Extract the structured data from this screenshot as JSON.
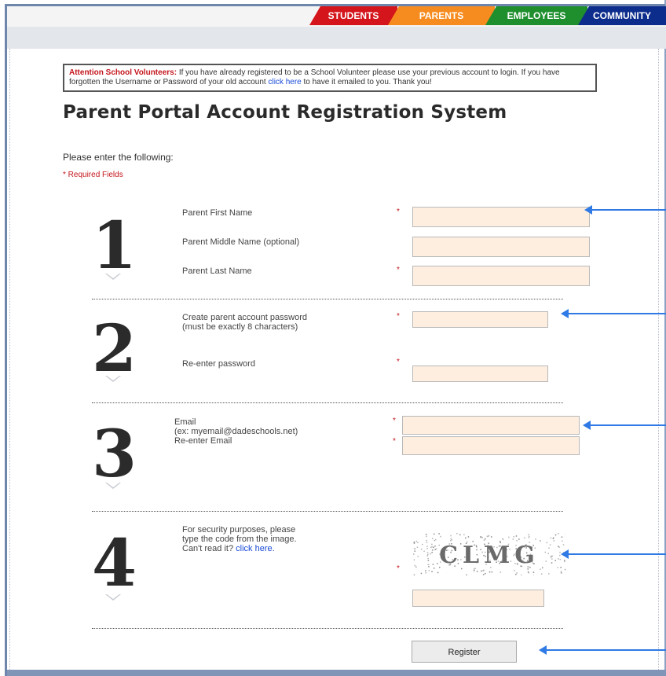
{
  "nav": {
    "tabs": [
      {
        "label": "STUDENTS",
        "color": "#d4151b"
      },
      {
        "label": "PARENTS",
        "color": "#f68b1f"
      },
      {
        "label": "EMPLOYEES",
        "color": "#1f8f2e"
      },
      {
        "label": "COMMUNITY",
        "color": "#0d2d8c"
      }
    ]
  },
  "notice": {
    "bold": "Attention School Volunteers:",
    "text1": " If you have already registered to be a School Volunteer please use your previous account to login. If you have forgotten the Username or Password of your old account ",
    "link": "click here",
    "text2": " to have it emailed to you. Thank you!"
  },
  "page": {
    "title": "Parent Portal Account Registration System",
    "intro": "Please enter the following:",
    "required_note": "* Required Fields"
  },
  "steps": [
    {
      "number": "1"
    },
    {
      "number": "2"
    },
    {
      "number": "3"
    },
    {
      "number": "4"
    }
  ],
  "fields": {
    "first_name_label": "Parent First Name",
    "middle_name_label": "Parent Middle Name (optional)",
    "last_name_label": "Parent Last Name",
    "password_label_1": "Create parent account password",
    "password_label_2": "(must be exactly 8 characters)",
    "reenter_password_label": "Re-enter password",
    "email_label": "Email",
    "email_example": "(ex: myemail@dadeschools.net)",
    "reenter_email_label": "Re-enter Email",
    "security_line_1": "For security purposes, please",
    "security_line_2": "type the code from the image.",
    "security_line_3": "Can't read it?",
    "security_link": "click here.",
    "required_star": "*"
  },
  "captcha": {
    "code": "CLMG"
  },
  "actions": {
    "register_label": "Register"
  },
  "colors": {
    "arrow": "#2f7ae5",
    "required": "#c4161c",
    "field_bg": "#fdeee0"
  }
}
